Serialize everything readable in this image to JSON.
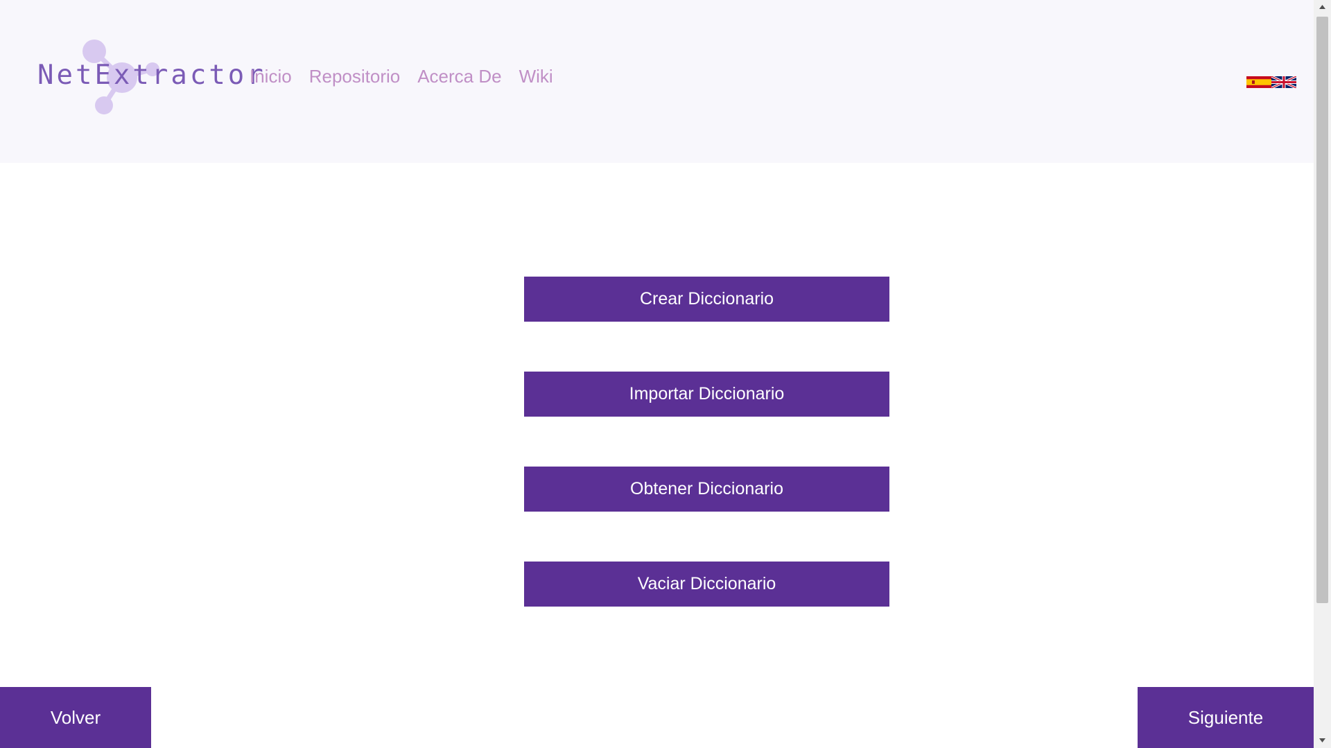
{
  "header": {
    "logo_text": "NetExtractor",
    "nav": [
      "Inicio",
      "Repositorio",
      "Acerca De",
      "Wiki"
    ],
    "flags": [
      "spain-flag-icon",
      "uk-flag-icon"
    ]
  },
  "actions": [
    "Crear Diccionario",
    "Importar Diccionario",
    "Obtener Diccionario",
    "Vaciar Diccionario"
  ],
  "footer": {
    "back_label": "Volver",
    "next_label": "Siguiente"
  },
  "colors": {
    "primary": "#5b3095",
    "header_bg": "#f8f7fc",
    "nav_link": "#c08fc6",
    "logo_text": "#7b5bb6",
    "logo_molecule": "#d8c9f0"
  }
}
